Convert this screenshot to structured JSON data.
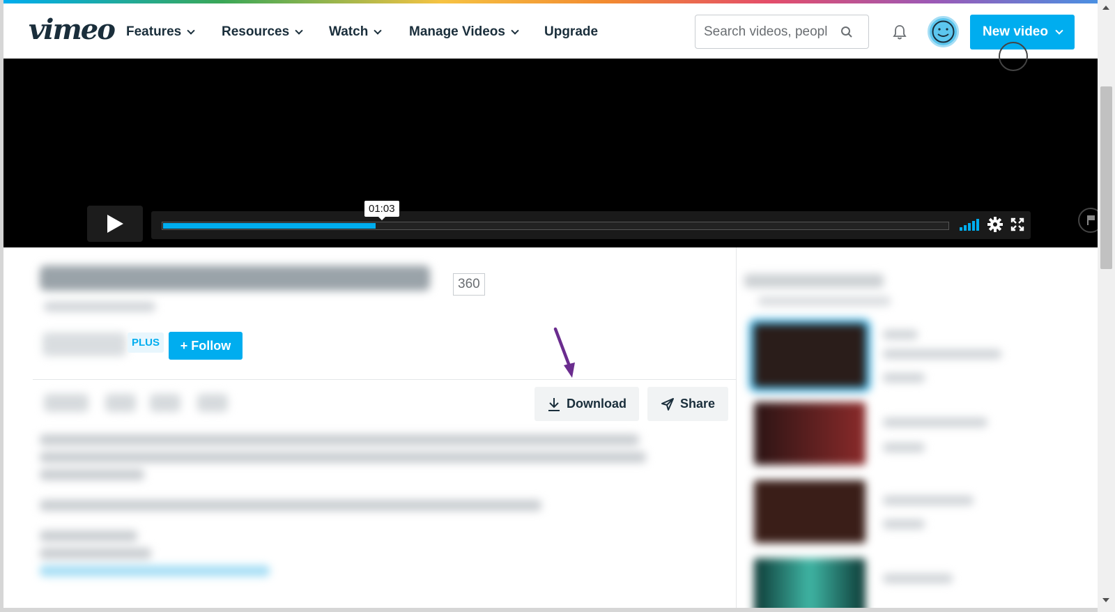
{
  "header": {
    "logo": "vimeo",
    "nav": [
      {
        "label": "Features",
        "dropdown": true
      },
      {
        "label": "Resources",
        "dropdown": true
      },
      {
        "label": "Watch",
        "dropdown": true
      },
      {
        "label": "Manage Videos",
        "dropdown": true
      },
      {
        "label": "Upgrade",
        "dropdown": false
      }
    ],
    "search_placeholder": "Search videos, peopl",
    "new_video_label": "New video",
    "icons": {
      "search": "search-icon",
      "notifications": "bell-icon",
      "avatar": "avatar-icon"
    }
  },
  "player": {
    "time_tooltip": "01:03",
    "progress": 0.27,
    "icons": [
      "play-icon",
      "volume-bars-icon",
      "gear-icon",
      "fullscreen-icon",
      "flag-icon"
    ]
  },
  "video": {
    "badge": "360",
    "plus_label": "PLUS",
    "follow_label": "+ Follow",
    "download_label": "Download",
    "share_label": "Share"
  },
  "colors": {
    "accent": "#00adef",
    "text": "#1a2e3b",
    "annotation_arrow": "#6a2c8e"
  }
}
